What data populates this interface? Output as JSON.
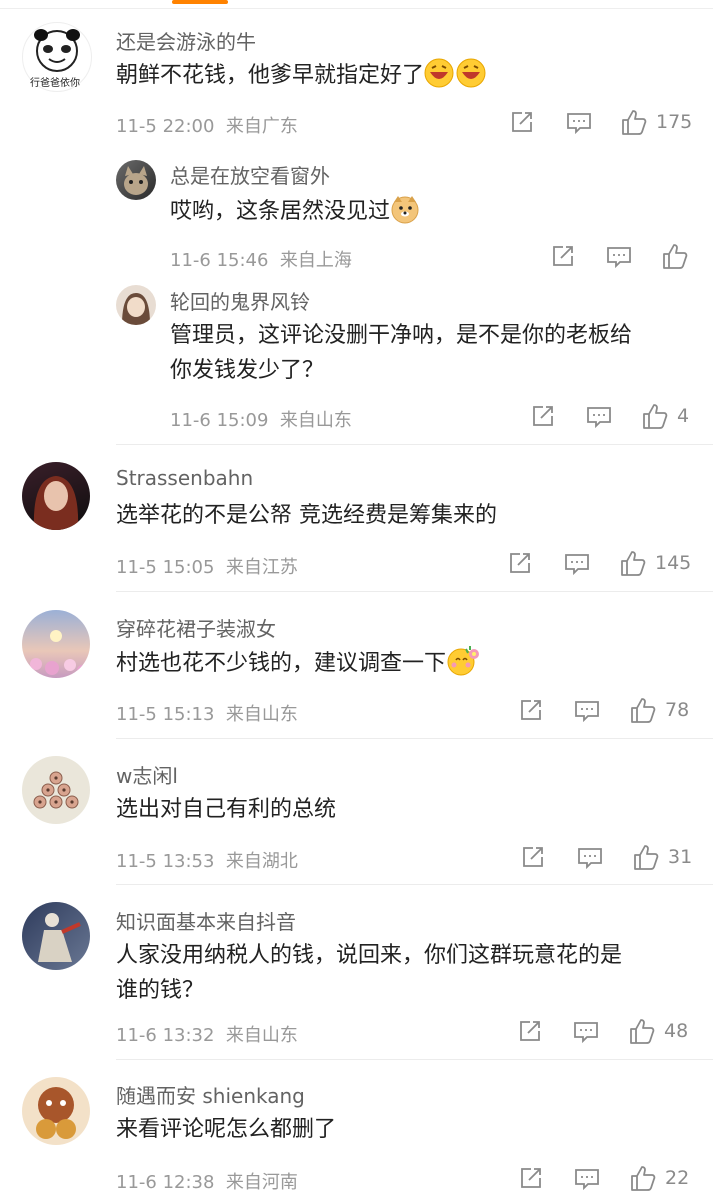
{
  "comments": [
    {
      "name": "还是会游泳的牛",
      "avatar_text": "行爸爸依你",
      "text": "朝鲜不花钱，他爹早就指定好了",
      "time": "11-5 22:00",
      "location": "来自广东",
      "likes": "175"
    },
    {
      "name": "总是在放空看窗外",
      "text": "哎哟，这条居然没见过",
      "time": "11-6 15:46",
      "location": "来自上海",
      "likes": ""
    },
    {
      "name": "轮回的鬼界风铃",
      "text_lines": [
        "管理员，这评论没删干净呐，是不是你的老板给",
        "你发钱发少了？"
      ],
      "time": "11-6 15:09",
      "location": "来自山东",
      "likes": "4"
    },
    {
      "name": "Strassenbahn",
      "text": "选举花的不是公帑  竞选经费是筹集来的",
      "time": "11-5 15:05",
      "location": "来自江苏",
      "likes": "145"
    },
    {
      "name": "穿碎花裙子装淑女",
      "text": "村选也花不少钱的，建议调查一下",
      "time": "11-5 15:13",
      "location": "来自山东",
      "likes": "78"
    },
    {
      "name": "w志闲l",
      "text": "选出对自己有利的总统",
      "time": "11-5 13:53",
      "location": "来自湖北",
      "likes": "31"
    },
    {
      "name": "知识面基本来自抖音",
      "text_lines": [
        "人家没用纳税人的钱，说回来，你们这群玩意花的是",
        "谁的钱？"
      ],
      "time": "11-6 13:32",
      "location": "来自山东",
      "likes": "48"
    },
    {
      "name": "随遇而安 shienkang",
      "text": "来看评论呢怎么都删了",
      "time": "11-6 12:38",
      "location": "来自河南",
      "likes": "22"
    }
  ],
  "colors": {
    "accent": "#ff8200",
    "meta": "#999999",
    "name": "#636363"
  }
}
